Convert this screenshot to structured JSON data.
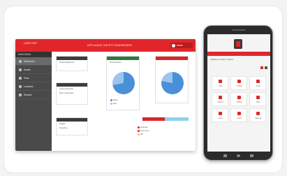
{
  "dashboard": {
    "brand_text": "LOGO TEXT",
    "title": "APPLIANCE SAFETY DASHBOARD",
    "user_button": "Admin",
    "sidebar": {
      "header": "MAIN MENU",
      "items": [
        {
          "label": "Dashboard",
          "active": true
        },
        {
          "label": "Assets"
        },
        {
          "label": "Tests"
        },
        {
          "label": "Locations"
        },
        {
          "label": "Reports"
        }
      ]
    },
    "panels": {
      "p1": {
        "header": "",
        "text1": "Total Appliances",
        "text2": ""
      },
      "p2": {
        "header": "",
        "text1": "Last Inspection",
        "text2": "Next Inspection"
      },
      "p3": {
        "header": "",
        "text1": "Failed",
        "text2": "Overdue"
      },
      "pie1": {
        "header": "",
        "text": "Test Results",
        "legend": [
          {
            "label": "Pass",
            "color": "#4a90d9"
          },
          {
            "label": "Fail",
            "color": "#9cc4ee"
          }
        ]
      },
      "pie2": {
        "header": "",
        "text": "",
        "legend": []
      },
      "alerts": {
        "legend": [
          {
            "label": "Overdue",
            "color": "#d9262b"
          },
          {
            "label": "Due Soon",
            "color": "#d9262b"
          },
          {
            "label": "OK",
            "color": "#f2c94c"
          }
        ]
      }
    }
  },
  "mobile": {
    "subtitle": "Appliance Safety Tracker",
    "tiles": [
      "Scan",
      "Assets",
      "Tests",
      "Report",
      "History",
      "Sites",
      "Users",
      "Alerts",
      "Settings"
    ]
  }
}
